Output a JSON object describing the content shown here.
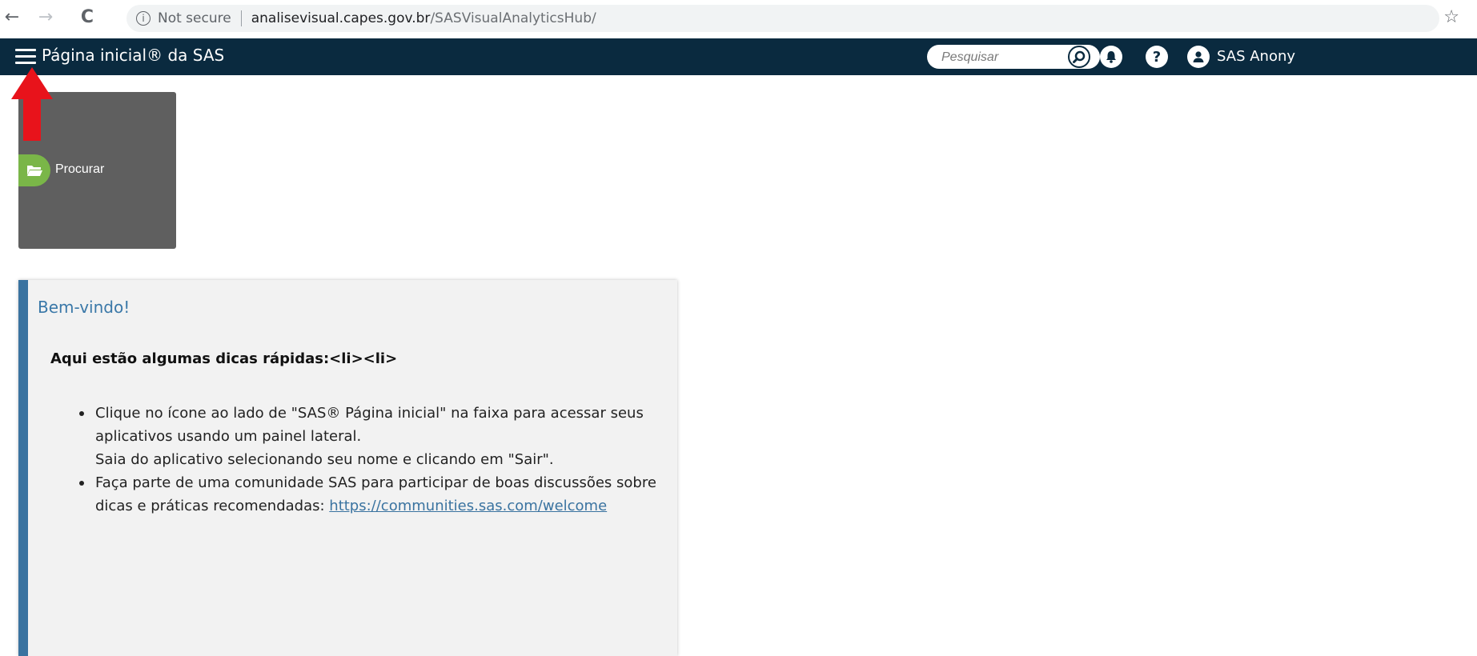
{
  "browser": {
    "back": "←",
    "forward": "→",
    "reload": "C",
    "security_label": "Not secure",
    "url_host": "analisevisual.capes.gov.br",
    "url_path": "/SASVisualAnalyticsHub/",
    "bookmark": "☆"
  },
  "banner": {
    "title": "Página inicial® da SAS",
    "search_placeholder": "Pesquisar",
    "help_glyph": "?",
    "user_name": "SAS Anony"
  },
  "tile": {
    "label": "Procurar"
  },
  "welcome": {
    "title": "Bem-vindo!",
    "subtitle": "Aqui estão algumas dicas rápidas:<li><li>",
    "tips": [
      {
        "line1": "Clique no ícone ao lado de \"SAS® Página inicial\" na faixa para acessar seus",
        "line2": "aplicativos usando um painel lateral.",
        "line3": "Saia do aplicativo selecionando seu nome e clicando em \"Sair\"."
      },
      {
        "line1": "Faça parte de uma comunidade SAS para participar de boas discussões sobre",
        "line2_prefix": "dicas e práticas recomendadas: ",
        "link": "https://communities.sas.com/welcome"
      }
    ]
  },
  "colors": {
    "banner_bg": "#0a2a3f",
    "tile_bg": "#5f5f5f",
    "tile_icon": "#7ab648",
    "accent": "#3a73a0",
    "annotation_arrow": "#e8131b"
  }
}
